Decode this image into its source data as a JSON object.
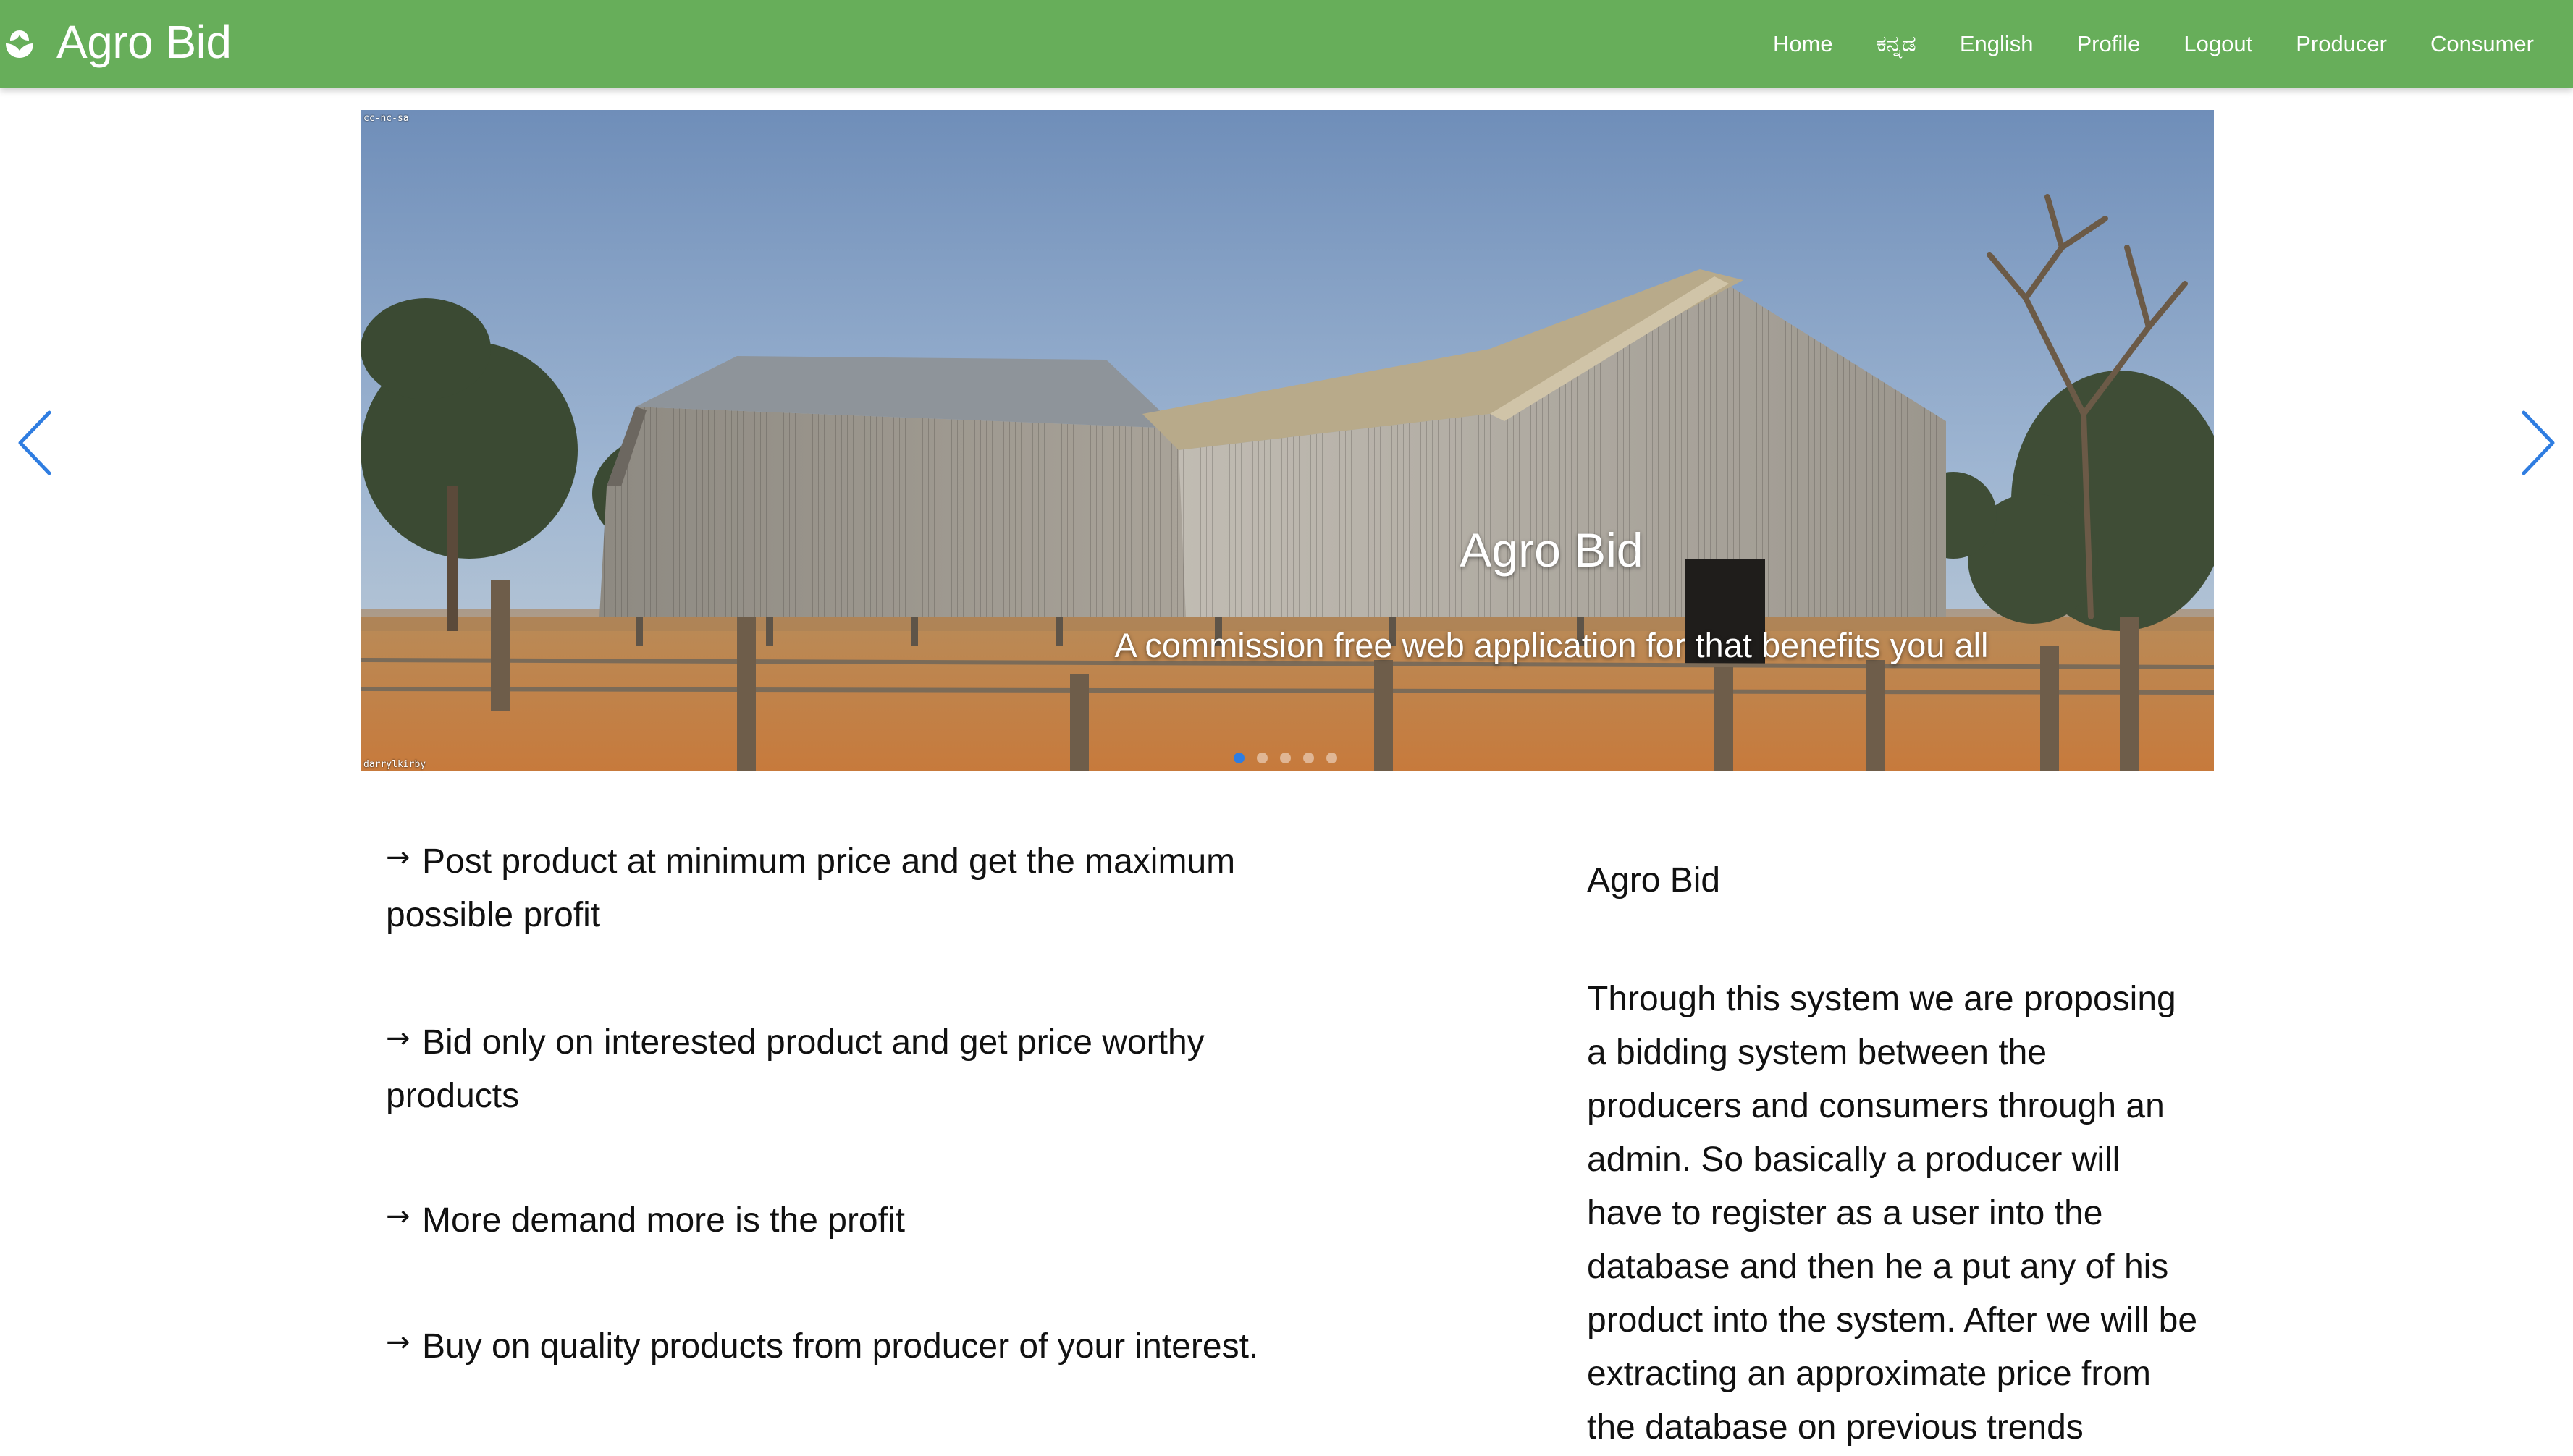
{
  "navbar": {
    "brand": "Agro Bid",
    "brand_icon": "sprout-icon",
    "links": [
      "Home",
      "ಕನ್ನಡ",
      "English",
      "Profile",
      "Logout",
      "Producer",
      "Consumer"
    ],
    "background_color": "#67ae5a"
  },
  "carousel": {
    "title": "Agro Bid",
    "subtitle": "A commission free web application for that benefits you all",
    "watermark_top": "cc-nc-sa",
    "watermark_bottom": "darrylkirby",
    "slide_count": 5,
    "active_slide": 1,
    "prev_icon": "chevron-left-icon",
    "next_icon": "chevron-right-icon",
    "control_color": "#2f7de1"
  },
  "features": [
    "Post product at minimum price and get the maximum possible profit",
    "Bid only on interested product and get price worthy products",
    "More demand more is the profit",
    "Buy on quality products from producer of your interest."
  ],
  "about": {
    "title": "Agro Bid",
    "text": "Through this system we are proposing a bidding system between the producers and consumers through an admin. So basically a producer will have to register as a user into the database and then he a put any of his product into the system. After we will be extracting an approximate price from the database on previous trends"
  }
}
